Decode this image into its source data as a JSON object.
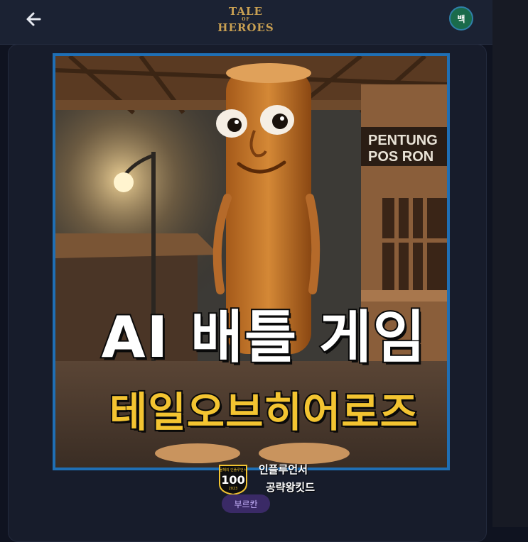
{
  "header": {
    "logo_line1": "TALE",
    "logo_line2": "OF",
    "logo_line3": "HEROES",
    "avatar_initial": "백",
    "back_icon": "arrow-left-icon"
  },
  "scene": {
    "sign_line1": "PENTUNG",
    "sign_line2": "POS RON"
  },
  "banner": {
    "title": "AI 배틀 게임",
    "subtitle": "테일오브히어로즈"
  },
  "badge": {
    "ring_text": "올해의 인플루언서",
    "number": "100",
    "year": "2023"
  },
  "influencer": {
    "line1": "인플루언서",
    "line2": "공략왕킷드"
  },
  "button": {
    "label": "부르칸"
  },
  "colors": {
    "accent_blue": "#1f6fb5",
    "gold": "#f3c431",
    "purple_button": "#3a2a66"
  }
}
